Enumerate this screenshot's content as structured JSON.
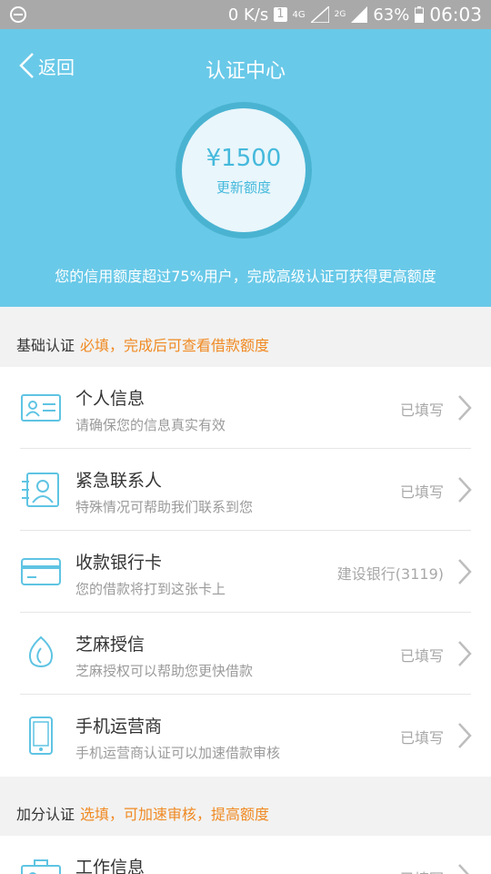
{
  "status_bar": {
    "net_speed": "0 K/s",
    "sim": "1",
    "network": "4G",
    "network_2g": "2G",
    "battery": "63%",
    "time": "06:03"
  },
  "header": {
    "back_label": "返回",
    "title": "认证中心"
  },
  "credit": {
    "amount": "¥1500",
    "update_label": "更新额度",
    "description": "您的信用额度超过75%用户，完成高级认证可获得更高额度"
  },
  "basic_section": {
    "title": "基础认证",
    "note": "必填，完成后可查看借款额度",
    "items": [
      {
        "title": "个人信息",
        "subtitle": "请确保您的信息真实有效",
        "status": "已填写",
        "icon": "id-card-icon"
      },
      {
        "title": "紧急联系人",
        "subtitle": "特殊情况可帮助我们联系到您",
        "status": "已填写",
        "icon": "contact-icon"
      },
      {
        "title": "收款银行卡",
        "subtitle": "您的借款将打到这张卡上",
        "status": "建设银行(3119)",
        "icon": "bank-card-icon"
      },
      {
        "title": "芝麻授信",
        "subtitle": "芝麻授权可以帮助您更快借款",
        "status": "已填写",
        "icon": "sesame-icon"
      },
      {
        "title": "手机运营商",
        "subtitle": "手机运营商认证可以加速借款审核",
        "status": "已填写",
        "icon": "phone-icon"
      }
    ]
  },
  "bonus_section": {
    "title": "加分认证",
    "note": "选填，可加速审核，提高额度",
    "items": [
      {
        "title": "工作信息",
        "status": "已填写",
        "icon": "work-icon"
      }
    ]
  },
  "colors": {
    "primary": "#69c9e8",
    "accent": "#f08a23",
    "icon": "#5fc4e3"
  }
}
